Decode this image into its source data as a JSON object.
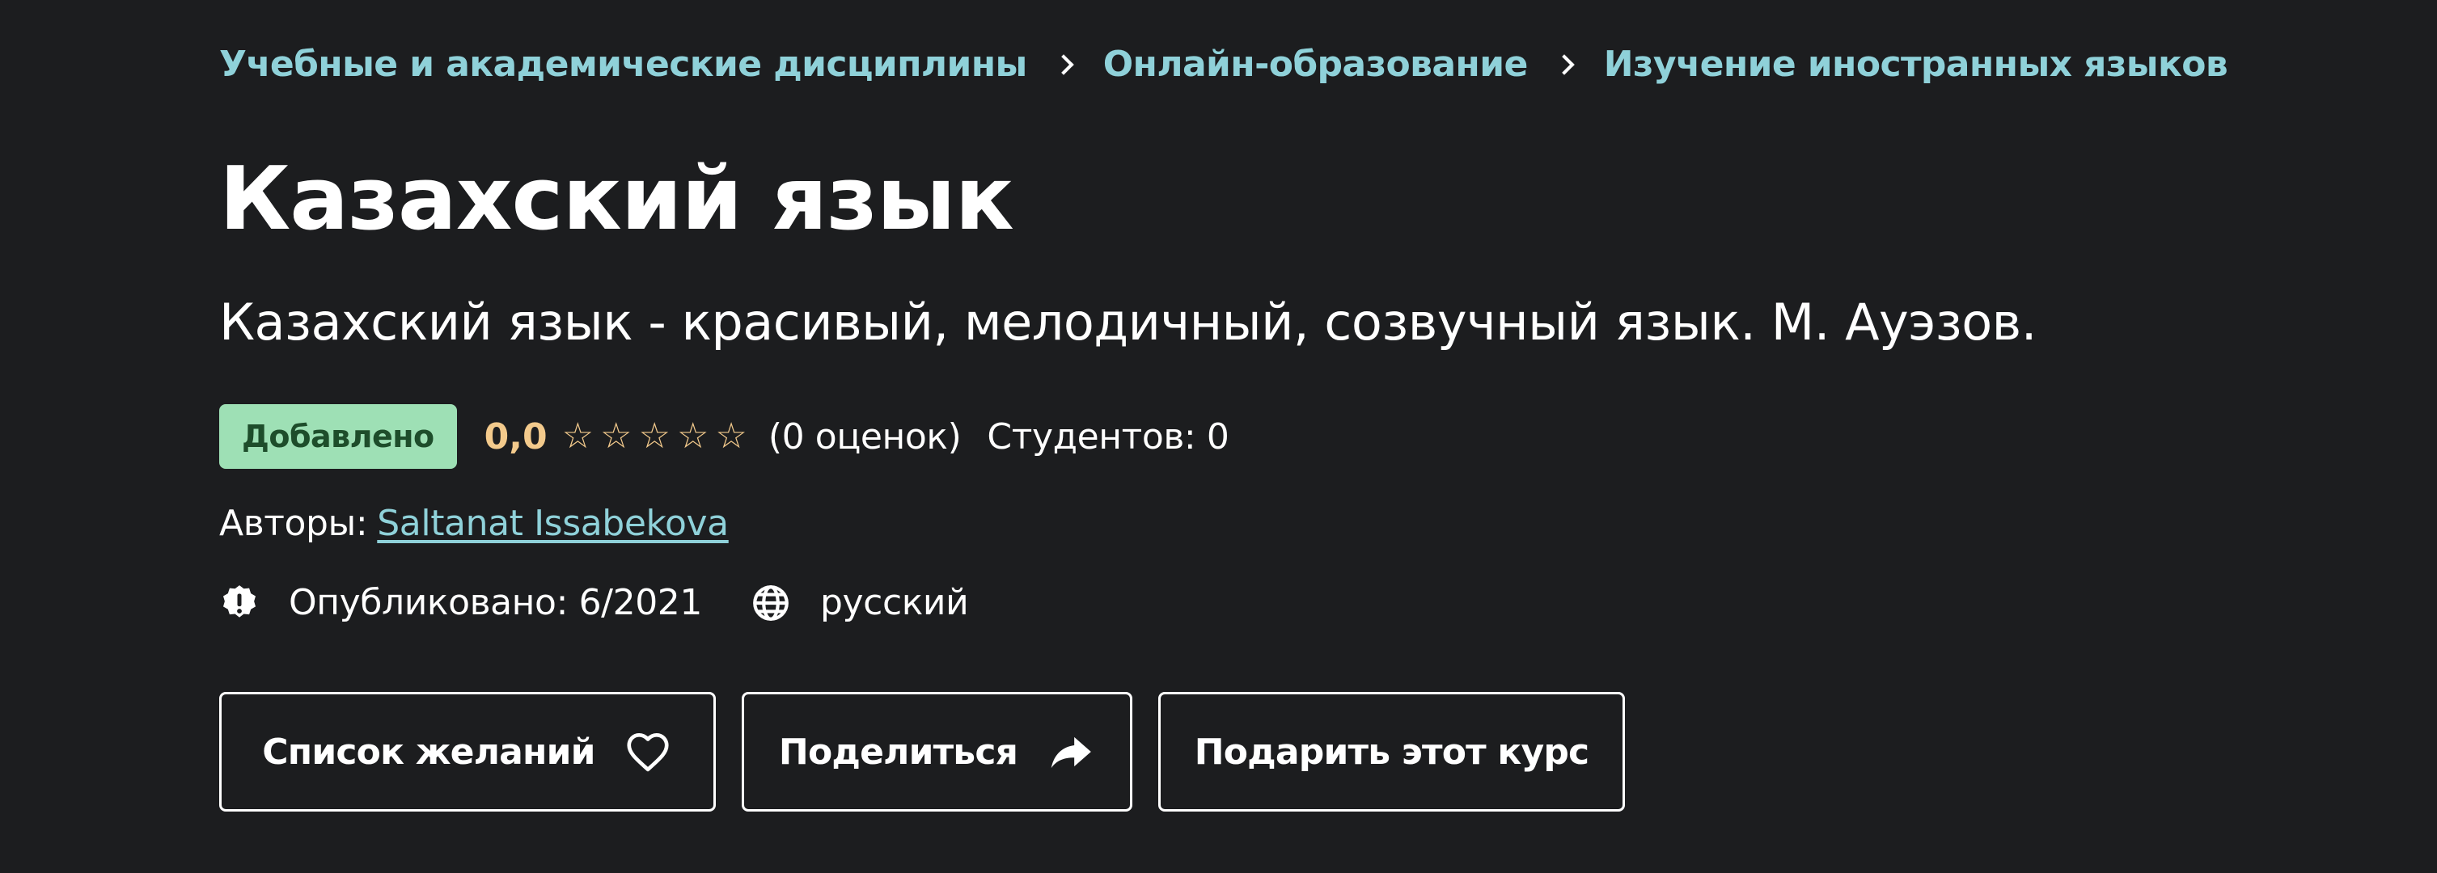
{
  "breadcrumb": {
    "items": [
      "Учебные и академические дисциплины",
      "Онлайн-образование",
      "Изучение иностранных языков"
    ]
  },
  "course": {
    "title": "Казахский язык",
    "subtitle": "Казахский язык - красивый, мелодичный, созвучный язык. М. Ауэзов.",
    "badge": "Добавлено",
    "rating": "0,0",
    "stars_filled": 0,
    "stars_total": 5,
    "rating_count": "(0 оценок)",
    "students": "Студентов: 0",
    "authors_label": "Авторы:",
    "author": "Saltanat Issabekova",
    "published": "Опубликовано: 6/2021",
    "language": "русский"
  },
  "actions": {
    "wishlist": "Список желаний",
    "share": "Поделиться",
    "gift": "Подарить этот курс"
  },
  "colors": {
    "background": "#1c1d1f",
    "link": "#8fd1d9",
    "rating": "#f3ca8c",
    "badge_bg": "#9ee0b5",
    "badge_text": "#1e4d2b"
  },
  "icons": {
    "separator": "chevron-right-icon",
    "star": "star-outline-icon",
    "published": "alert-badge-icon",
    "language": "globe-icon",
    "wishlist": "heart-icon",
    "share": "share-arrow-icon"
  }
}
